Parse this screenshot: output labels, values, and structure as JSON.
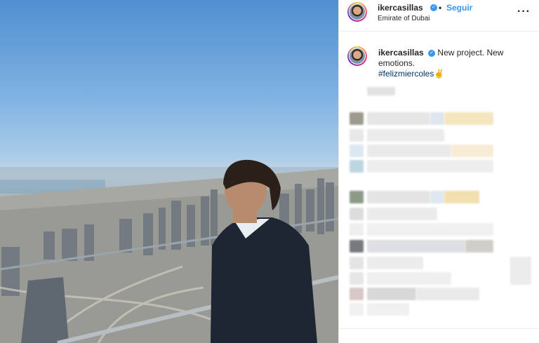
{
  "post": {
    "username": "ikercasillas",
    "follow_label": "Seguir",
    "location": "Emirate of Dubai",
    "more_icon": "more-horizontal-icon",
    "caption": {
      "username": "ikercasillas",
      "text": "New project. New emotions.",
      "hashtag": "#felizmiercoles✌",
      "verified_icon": "verified-icon"
    },
    "colors": {
      "accent": "#3897f0",
      "hashtag": "#00376b",
      "text": "#262626"
    }
  }
}
